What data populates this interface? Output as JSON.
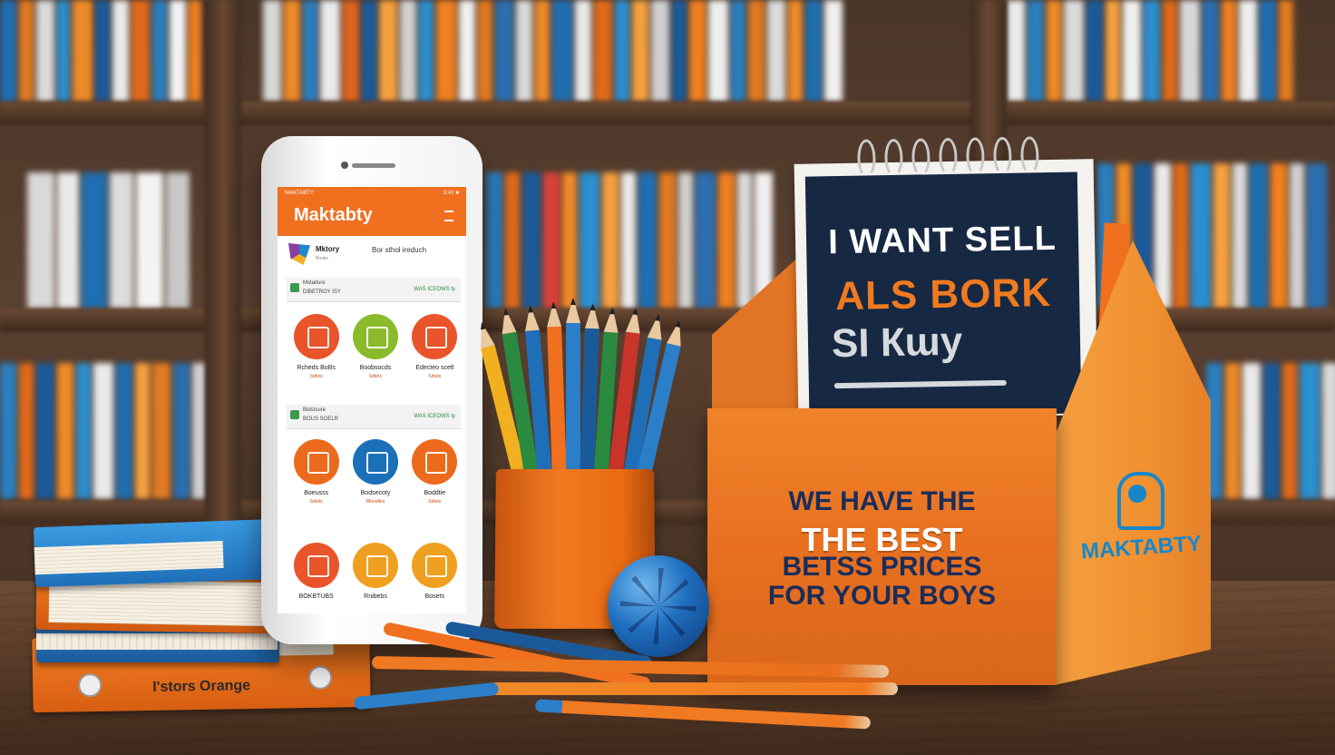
{
  "phone": {
    "status_left": "MAKTABTY",
    "status_right": "9:41 ■",
    "app_title": "Maktabty",
    "brand_name": "Mktory",
    "brand_sub": "Books",
    "brand_link": "Bor sthol ireduch",
    "section1": {
      "label": "Mstaiture",
      "label2": "DIBETROY ISY",
      "link": "WAS ICEOWS ty"
    },
    "section2": {
      "label": "Bidstsure",
      "label2": "BOUS SOELR",
      "link": "WAS ICEOWS ty"
    },
    "grid1": [
      {
        "label": "Rcheds BoBs",
        "sub": "Sdtets",
        "color": "#e9542a"
      },
      {
        "label": "Boobsocds",
        "sub": "Sdtets",
        "color": "#8bbb2c"
      },
      {
        "label": "Edecteo scetl",
        "sub": "Sdtets",
        "color": "#e9542a"
      }
    ],
    "grid2": [
      {
        "label": "Boeusss",
        "sub": "Sdtets",
        "color": "#ec6a1c"
      },
      {
        "label": "Bodsecoty",
        "sub": "Rltesdtes",
        "color": "#1b70b8"
      },
      {
        "label": "Boddtie",
        "sub": "Sdtets",
        "color": "#ec6a1c"
      }
    ],
    "grid3": [
      {
        "label": "BOKBTUBS",
        "sub": "",
        "color": "#e9542a"
      },
      {
        "label": "Rnibebs",
        "sub": "",
        "color": "#f0a020"
      },
      {
        "label": "Bosets",
        "sub": "",
        "color": "#f0a020"
      }
    ]
  },
  "notepad": {
    "line1": "I WANT SELL",
    "line2": "ALS BORK",
    "line3": "SI Кɯy"
  },
  "box": {
    "line1": "WE HAVE THE",
    "line2": "THE BEST",
    "line3": "BETSS PRICES",
    "line4": "FOR YOUR BOYS",
    "side_brand": "MAKTABTY"
  },
  "book_cover_text": "I'stors Orange",
  "colors": {
    "orange": "#f07020",
    "navy": "#172843",
    "blue": "#1a86c8"
  }
}
